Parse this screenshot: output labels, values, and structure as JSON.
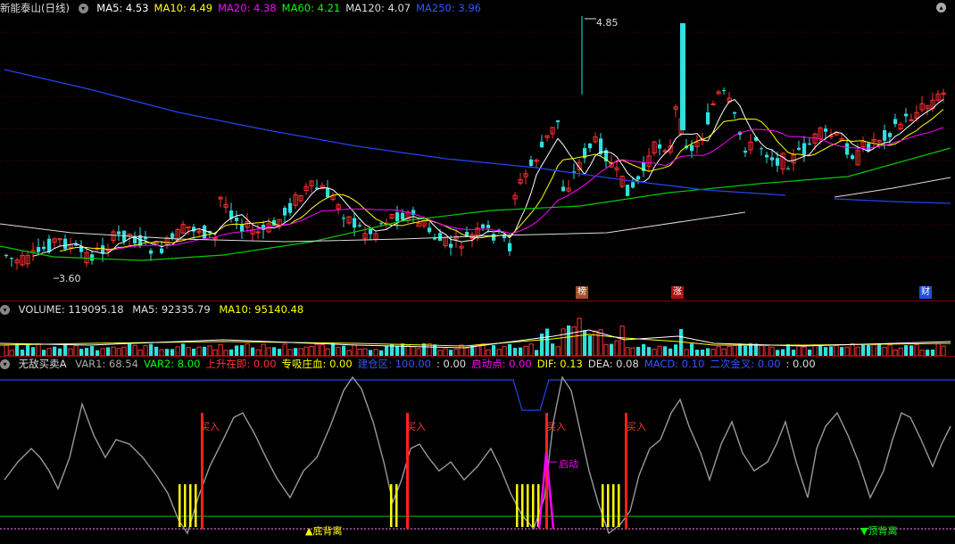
{
  "main": {
    "title": "新能泰山(日线)",
    "ma": [
      {
        "label": "MA5: 4.53",
        "color": "#ffffff"
      },
      {
        "label": "MA10: 4.49",
        "color": "#ffff00"
      },
      {
        "label": "MA20: 4.38",
        "color": "#ff00ff"
      },
      {
        "label": "MA60: 4.21",
        "color": "#00ff00"
      },
      {
        "label": "MA120: 4.07",
        "color": "#dddddd"
      },
      {
        "label": "MA250: 3.96",
        "color": "#3355ff"
      }
    ],
    "high_label": "4.85",
    "low_label": "3.60",
    "badges": [
      {
        "text": "榜",
        "color": "#a0522d"
      },
      {
        "text": "涨",
        "color": "#aa1111"
      },
      {
        "text": "财",
        "color": "#1e4fd8"
      }
    ]
  },
  "volume": {
    "title": "VOLUME: 119095.18",
    "ma5": "MA5: 92335.79",
    "ma10": "MA10: 95140.48"
  },
  "indicator": {
    "title": "无敌买卖A",
    "items": [
      {
        "label": "VAR1: 68.54",
        "color": "#aaaaaa"
      },
      {
        "label": "VAR2: 8.00",
        "color": "#00ff00"
      },
      {
        "label": "上升在即: 0.00",
        "color": "#ff3333"
      },
      {
        "label": "专吸庄血: 0.00",
        "color": "#ffff00"
      },
      {
        "label": "建仓区: 100.00",
        "color": "#3355ff"
      },
      {
        "label": ": 0.00",
        "color": "#dddddd"
      },
      {
        "label": "启动点: 0.00",
        "color": "#ff00ff"
      },
      {
        "label": "DIF: 0.13",
        "color": "#ffff00"
      },
      {
        "label": "DEA: 0.08",
        "color": "#dddddd"
      },
      {
        "label": "MACD: 0.10",
        "color": "#3355ff"
      },
      {
        "label": "二次金叉: 0.00",
        "color": "#3355ff"
      },
      {
        "label": ": 0.00",
        "color": "#dddddd"
      }
    ],
    "buy_label": "买入",
    "start_label": "启动",
    "bottom_div": "▲底背离",
    "top_div": "▼顶背离"
  }
}
